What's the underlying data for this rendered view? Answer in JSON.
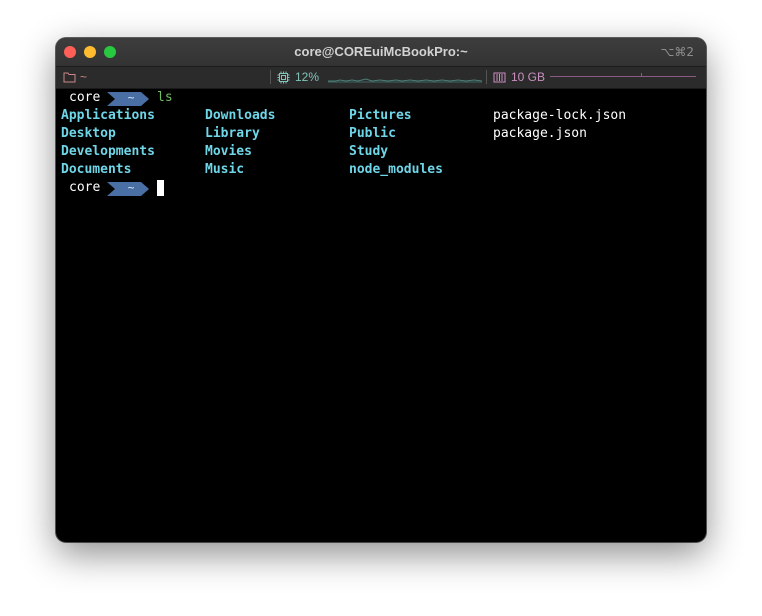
{
  "window": {
    "title": "core@COREuiMcBookPro:~",
    "shortcut": "⌥⌘2"
  },
  "statusbar": {
    "directory": "~",
    "cpu_percent": "12%",
    "memory": "10 GB",
    "icons": [
      "folder-icon",
      "cpu-icon",
      "memory-icon"
    ]
  },
  "prompt": {
    "user": "core",
    "path": "~",
    "command": "ls",
    "segment_color": "#4a6fa5"
  },
  "listing": {
    "columns": [
      [
        {
          "name": "Applications",
          "type": "dir"
        },
        {
          "name": "Desktop",
          "type": "dir"
        },
        {
          "name": "Developments",
          "type": "dir"
        },
        {
          "name": "Documents",
          "type": "dir"
        }
      ],
      [
        {
          "name": "Downloads",
          "type": "dir"
        },
        {
          "name": "Library",
          "type": "dir"
        },
        {
          "name": "Movies",
          "type": "dir"
        },
        {
          "name": "Music",
          "type": "dir"
        }
      ],
      [
        {
          "name": "Pictures",
          "type": "dir"
        },
        {
          "name": "Public",
          "type": "dir"
        },
        {
          "name": "Study",
          "type": "dir"
        },
        {
          "name": "node_modules",
          "type": "dir"
        }
      ],
      [
        {
          "name": "package-lock.json",
          "type": "file"
        },
        {
          "name": "package.json",
          "type": "file"
        }
      ]
    ]
  },
  "colors": {
    "directory": "#6fd6e8",
    "file": "#ffffff",
    "command": "#6dbf5f",
    "cpu": "#7fc4b8",
    "memory": "#c98fbf"
  }
}
